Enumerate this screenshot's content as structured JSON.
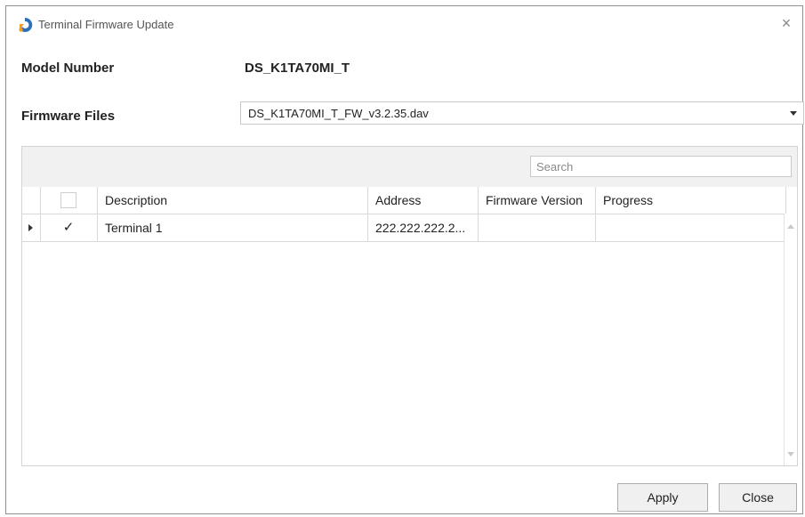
{
  "window": {
    "title": "Terminal Firmware Update",
    "app_icon": "app-logo-icon",
    "close_icon": "close-icon",
    "close_glyph": "×"
  },
  "model": {
    "label": "Model Number",
    "value": "DS_K1TA70MI_T"
  },
  "firmware": {
    "label": "Firmware Files",
    "selected": "DS_K1TA70MI_T_FW_v3.2.35.dav"
  },
  "search": {
    "placeholder": "Search"
  },
  "table": {
    "columns": {
      "description": "Description",
      "address": "Address",
      "firmware_version": "Firmware Version",
      "progress": "Progress"
    },
    "rows": [
      {
        "checked": true,
        "check_glyph": "✓",
        "description": "Terminal 1",
        "address": "222.222.222.2...",
        "firmware_version": "",
        "progress": ""
      }
    ]
  },
  "buttons": {
    "apply": "Apply",
    "close": "Close"
  },
  "colors": {
    "window_border": "#8f8f8f",
    "toolbar_bg": "#f1f1f1",
    "button_bg": "#f0f0f0",
    "logo_orange": "#f39c2a",
    "logo_blue": "#2f6fb3"
  }
}
